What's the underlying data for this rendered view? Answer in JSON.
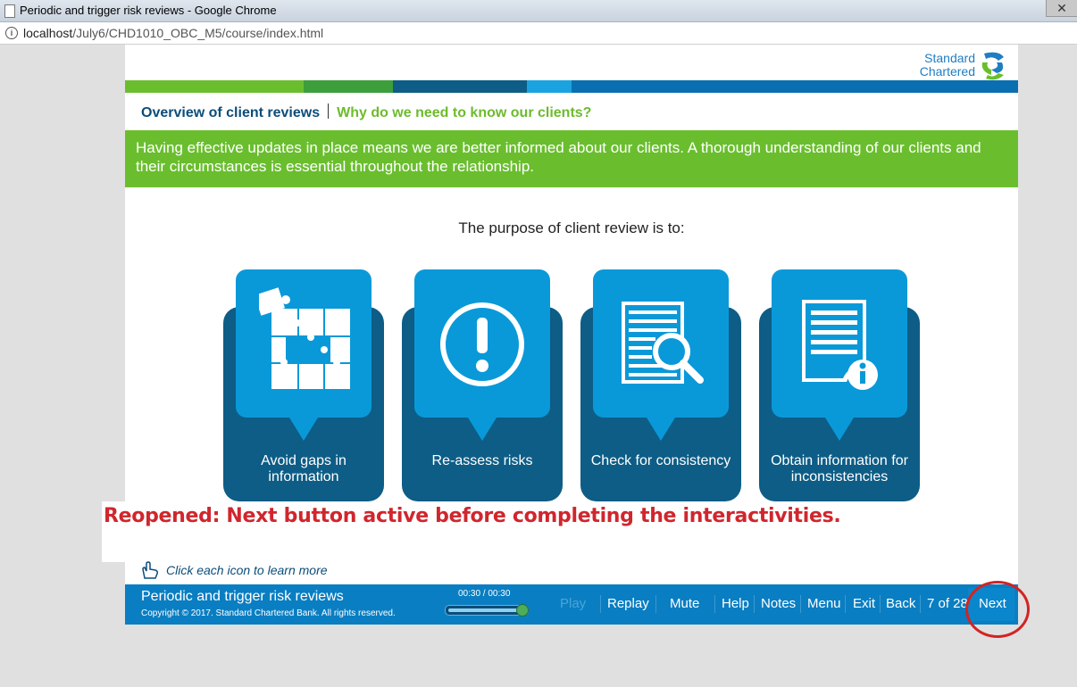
{
  "browser": {
    "title": "Periodic and trigger risk reviews - Google Chrome",
    "close_glyph": "✕",
    "url_host": "localhost",
    "url_path": "/July6/CHD1010_OBC_M5/course/index.html"
  },
  "brand": {
    "line1": "Standard",
    "line2": "Chartered"
  },
  "breadcrumb": {
    "section": "Overview of client reviews",
    "topic": "Why do we need to know our clients?"
  },
  "banner": "Having effective updates in place means we are better informed about our clients. A thorough understanding of our clients and their circumstances is essential throughout the relationship.",
  "purpose": "The purpose of client review is to:",
  "cards": [
    {
      "label": "Avoid gaps in information",
      "icon": "puzzle-icon"
    },
    {
      "label": "Re-assess risks",
      "icon": "exclamation-icon"
    },
    {
      "label": "Check for consistency",
      "icon": "document-magnifier-icon"
    },
    {
      "label": "Obtain information for inconsistencies",
      "icon": "document-info-icon"
    }
  ],
  "annotation": "Reopened: Next button active before completing the interactivities.",
  "hint": "Click each icon to learn more",
  "footer": {
    "course_title": "Periodic and trigger risk reviews",
    "copyright": "Copyright © 2017. Standard Chartered Bank. All rights reserved.",
    "time": "00:30 / 00:30",
    "progress": 1.0,
    "play": "Play",
    "replay": "Replay",
    "mute": "Mute",
    "help": "Help",
    "notes": "Notes",
    "menu": "Menu",
    "exit": "Exit",
    "back": "Back",
    "page": "7 of 28",
    "next": "Next"
  },
  "colors": {
    "green": "#6abe2e",
    "blue": "#0a99d8",
    "navy": "#0d5d86",
    "nav": "#0a7ec2",
    "annotation": "#d0262d"
  }
}
